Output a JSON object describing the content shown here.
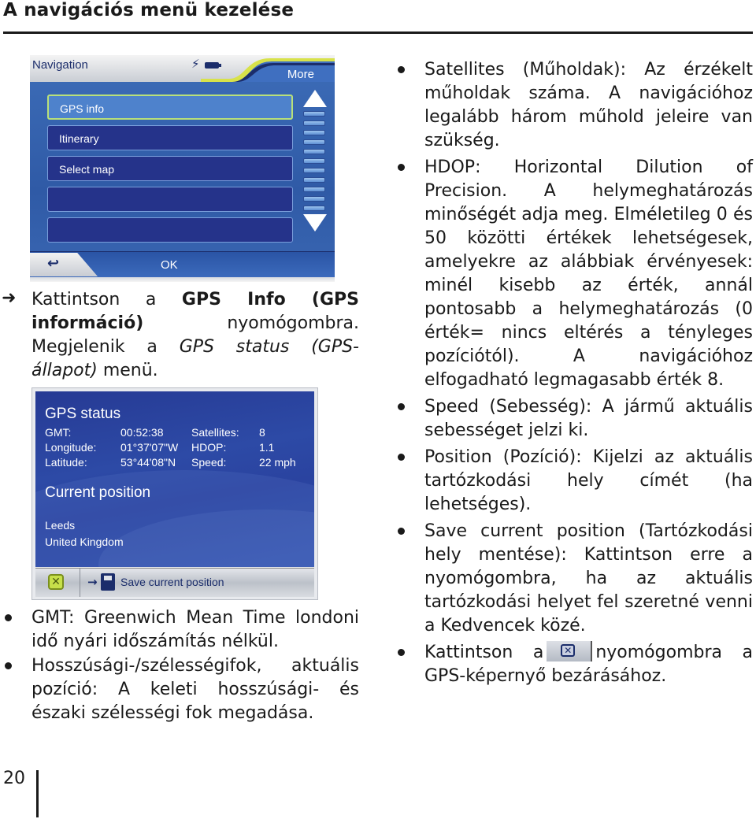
{
  "page": {
    "title": "A navigációs menü kezelése",
    "page_number": "20"
  },
  "nav_screen": {
    "title": "Navigation",
    "more_label": "More",
    "items": [
      "GPS info",
      "Itinerary",
      "Select map",
      "",
      ""
    ],
    "selected_index": 0,
    "ok_label": "OK",
    "icons": {
      "status": "bolt-icon",
      "battery": "battery-icon",
      "back": "back-arrow-icon"
    }
  },
  "instruction": {
    "marker": "➜",
    "text_1": "Kattintson a ",
    "bold_1": "GPS Info (GPS információ)",
    "text_2": " nyomógombra. Megjelenik a ",
    "italic_1": "GPS status (GPS-állapot)",
    "text_3": " menü."
  },
  "gps_screen": {
    "heading": "GPS status",
    "rows": [
      {
        "label": "GMT:",
        "value": "00:52:38",
        "label2": "Satellites:",
        "value2": "8"
      },
      {
        "label": "Longitude:",
        "value": "01°37'07\"W",
        "label2": "HDOP:",
        "value2": "1.1"
      },
      {
        "label": "Latitude:",
        "value": "53°44'08\"N",
        "label2": "Speed:",
        "value2": "22 mph"
      }
    ],
    "position_heading": "Current position",
    "address_line_1": "Leeds",
    "address_line_2": "United Kingdom",
    "save_label": "Save current position"
  },
  "left_bullets": [
    "GMT: Greenwich Mean Time londoni idő nyári időszámítás nélkül.",
    "Hosszúsági-/szélességifok, aktuális pozíció: A keleti hosszúsági- és északi szélességi fok megadása."
  ],
  "right_bullets": [
    "Satellites (Műholdak): Az érzékelt műholdak száma. A navigációhoz legalább három műhold jeleire van szükség.",
    "HDOP: Horizontal Dilution of Precision. A helymeghatározás minőségét adja meg. Elméletileg 0 és 50 közötti értékek lehetségesek, amelyekre az alábbiak érvényesek: minél kisebb az érték, annál pontosabb a helymeghatározás (0 érték= nincs eltérés a tényleges pozíciótól). A navigációhoz elfogadható legmagasabb érték 8.",
    "Speed (Sebesség): A jármű aktuális sebességet jelzi ki.",
    "Position (Pozíció): Kijelzi az aktuális tartózkodási hely címét (ha lehetséges).",
    "Save current position (Tartózkodási hely mentése): Kattintson erre a nyomógombra, ha az aktuális tartózkodási helyet fel szeretné venni a Kedvencek közé."
  ],
  "last_bullet": {
    "text_before": "Kattintson a",
    "button_icon": "close-x-icon",
    "text_after": "nyomógombra a GPS-képernyő bezárásához."
  }
}
